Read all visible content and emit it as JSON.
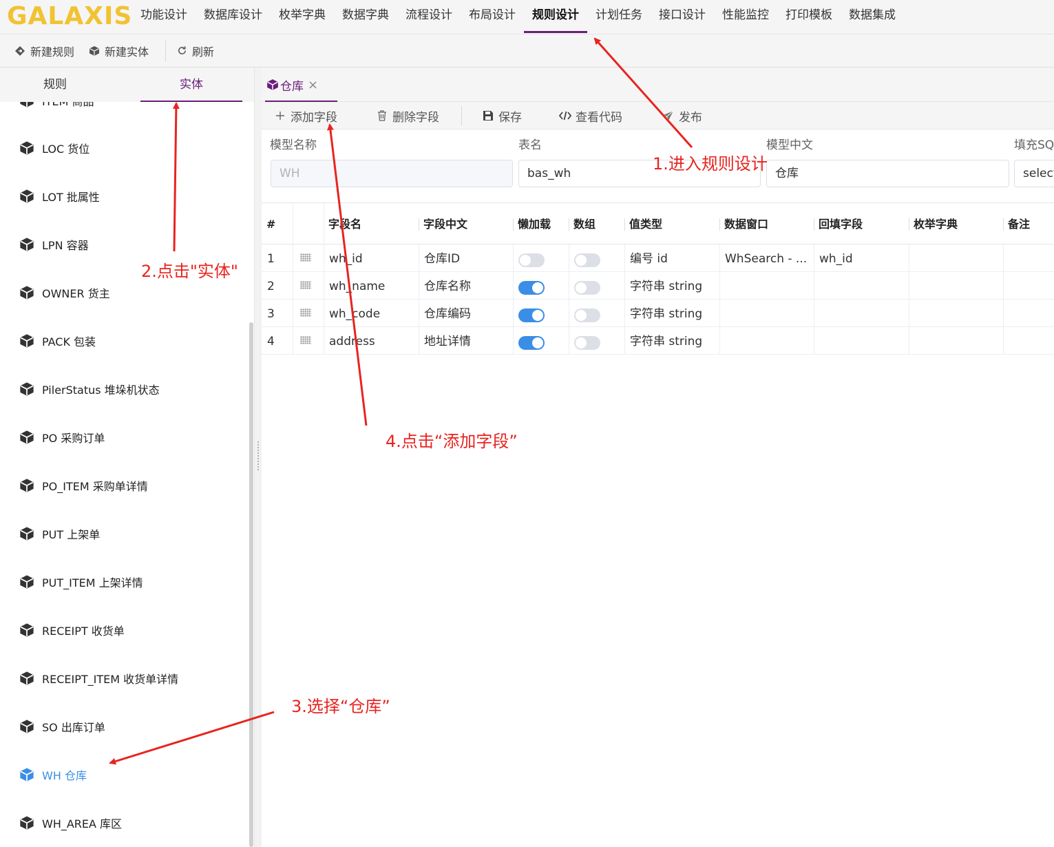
{
  "app": {
    "logo": "GALAXIS",
    "nav": [
      "功能设计",
      "数据库设计",
      "枚举字典",
      "数据字典",
      "流程设计",
      "布局设计",
      "规则设计",
      "计划任务",
      "接口设计",
      "性能监控",
      "打印模板",
      "数据集成"
    ],
    "active_nav": "规则设计"
  },
  "toolbar": {
    "new_rule": "新建规则",
    "new_entity": "新建实体",
    "refresh": "刷新"
  },
  "sidebar": {
    "tabs": [
      "规则",
      "实体"
    ],
    "active_tab": "实体",
    "partial_item": "ITEM 商品",
    "items": [
      "LOC 货位",
      "LOT 批属性",
      "LPN 容器",
      "OWNER 货主",
      "PACK 包装",
      "PilerStatus 堆垛机状态",
      "PO 采购订单",
      "PO_ITEM 采购单详情",
      "PUT 上架单",
      "PUT_ITEM 上架详情",
      "RECEIPT 收货单",
      "RECEIPT_ITEM 收货单详情",
      "SO 出库订单",
      "WH 仓库",
      "WH_AREA 库区"
    ],
    "selected": "WH 仓库"
  },
  "doc_tab": {
    "label": "仓库",
    "close": "×"
  },
  "field_toolbar": {
    "add": "添加字段",
    "delete": "删除字段",
    "save": "保存",
    "view_code": "查看代码",
    "publish": "发布"
  },
  "form": {
    "model_name_label": "模型名称",
    "model_name_value": "WH",
    "table_label": "表名",
    "table_value": "bas_wh",
    "model_cn_label": "模型中文",
    "model_cn_value": "仓库",
    "fill_sql_label": "填充SQ",
    "fill_sql_value": "select"
  },
  "grid": {
    "headers": [
      "#",
      "字段名",
      "字段中文",
      "懒加载",
      "数组",
      "值类型",
      "数据窗口",
      "回填字段",
      "枚举字典",
      "备注"
    ],
    "rows": [
      {
        "n": "1",
        "name": "wh_id",
        "cn": "仓库ID",
        "lazy": false,
        "array": false,
        "type": "编号 id",
        "window": "WhSearch - ...",
        "backfill": "wh_id",
        "enum": "",
        "note": ""
      },
      {
        "n": "2",
        "name": "wh_name",
        "cn": "仓库名称",
        "lazy": true,
        "array": false,
        "type": "字符串 string",
        "window": "",
        "backfill": "",
        "enum": "",
        "note": ""
      },
      {
        "n": "3",
        "name": "wh_code",
        "cn": "仓库编码",
        "lazy": true,
        "array": false,
        "type": "字符串 string",
        "window": "",
        "backfill": "",
        "enum": "",
        "note": ""
      },
      {
        "n": "4",
        "name": "address",
        "cn": "地址详情",
        "lazy": true,
        "array": false,
        "type": "字符串 string",
        "window": "",
        "backfill": "",
        "enum": "",
        "note": ""
      }
    ]
  },
  "annotations": {
    "step1": "1.进入规则设计",
    "step2": "2.点击\"实体\"",
    "step3": "3.选择“仓库”",
    "step4": "4.点击“添加字段”"
  },
  "colors": {
    "accent": "#6a1d7a",
    "logo": "#f1c232",
    "switch_on": "#3a8ee6",
    "annotation": "#e8231f",
    "selected_item": "#3a8ee6"
  }
}
